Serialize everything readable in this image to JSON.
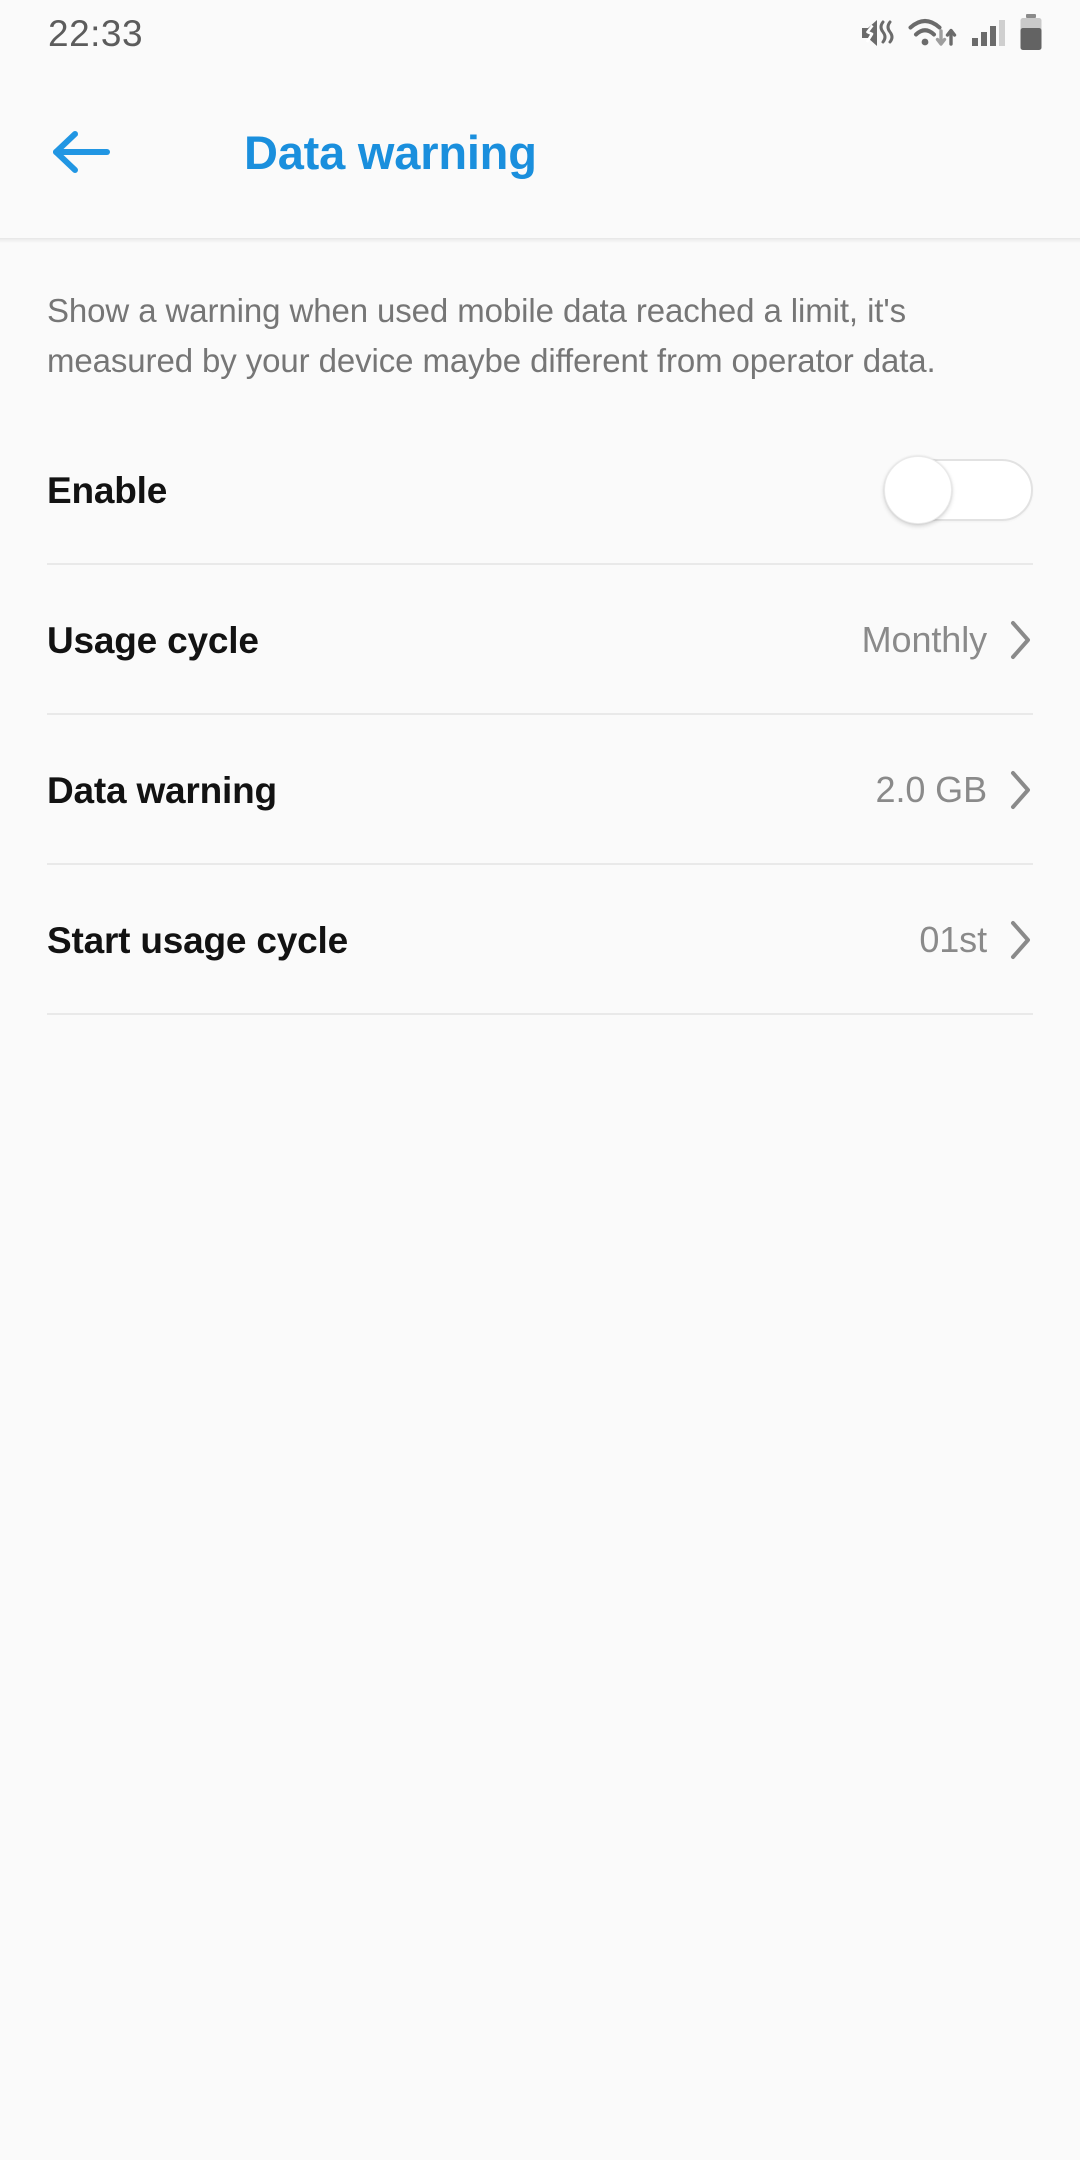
{
  "status_bar": {
    "time": "22:33",
    "icons": [
      {
        "name": "volume-mute-vibrate-icon"
      },
      {
        "name": "wifi-data-transfer-icon"
      },
      {
        "name": "cellular-signal-icon"
      },
      {
        "name": "battery-icon"
      }
    ]
  },
  "app_bar": {
    "back_label": "",
    "title": "Data warning",
    "accent_color": "#1a8fdd"
  },
  "main": {
    "description": "Show a warning when used mobile data reached a limit, it's measured by your device maybe different from operator data.",
    "rows": [
      {
        "label": "Enable",
        "type": "toggle",
        "checked": false
      },
      {
        "label": "Usage cycle",
        "type": "navigation",
        "value": "Monthly"
      },
      {
        "label": "Data warning",
        "type": "navigation",
        "value": "2.0 GB"
      },
      {
        "label": "Start usage cycle",
        "type": "navigation",
        "value": "01st"
      }
    ]
  }
}
